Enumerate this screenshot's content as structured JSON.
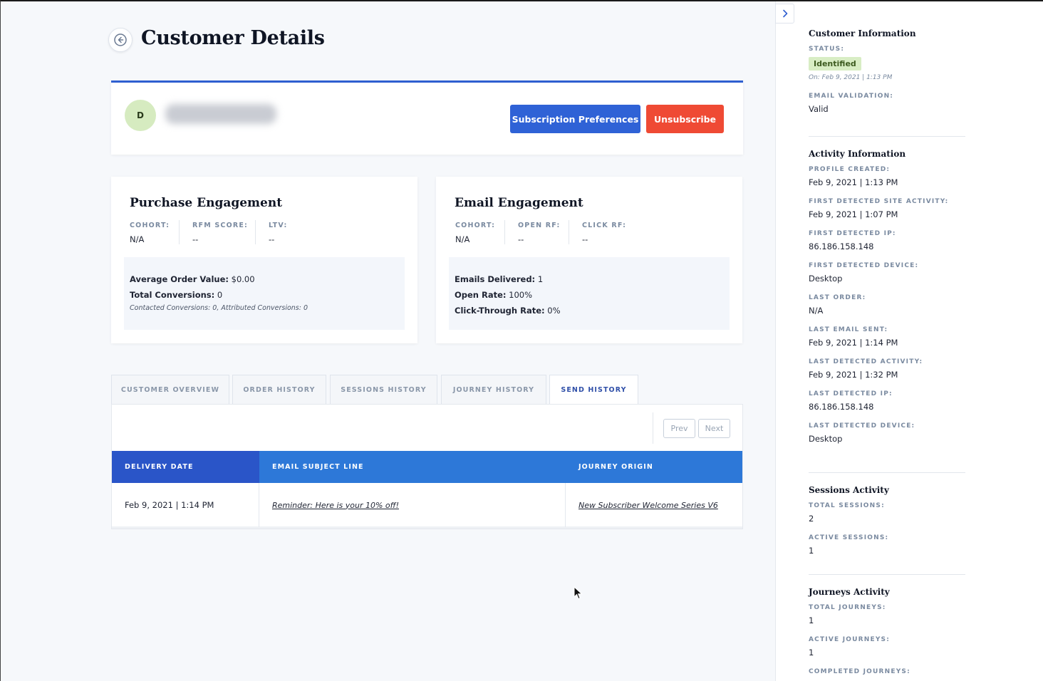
{
  "page": {
    "title": "Customer Details"
  },
  "profile": {
    "avatar_initial": "D",
    "subscription_button": "Subscription Preferences",
    "unsubscribe_button": "Unsubscribe"
  },
  "purchase": {
    "title": "Purchase Engagement",
    "metrics": [
      {
        "label": "COHORT:",
        "value": "N/A"
      },
      {
        "label": "RFM SCORE:",
        "value": "--"
      },
      {
        "label": "LTV:",
        "value": "--"
      }
    ],
    "aov_label": "Average Order Value:",
    "aov_value": " $0.00",
    "conv_label": "Total Conversions:",
    "conv_value": " 0",
    "note": "Contacted Conversions: 0, Attributed Conversions: 0"
  },
  "email": {
    "title": "Email Engagement",
    "metrics": [
      {
        "label": "COHORT:",
        "value": "N/A"
      },
      {
        "label": "OPEN RF:",
        "value": "--"
      },
      {
        "label": "CLICK RF:",
        "value": "--"
      }
    ],
    "delivered_label": "Emails Delivered:",
    "delivered_value": " 1",
    "open_label": "Open Rate:",
    "open_value": " 100%",
    "ctr_label": "Click-Through Rate:",
    "ctr_value": " 0%"
  },
  "tabs": [
    {
      "label": "CUSTOMER OVERVIEW"
    },
    {
      "label": "ORDER HISTORY"
    },
    {
      "label": "SESSIONS HISTORY"
    },
    {
      "label": "JOURNEY HISTORY"
    },
    {
      "label": "SEND HISTORY"
    }
  ],
  "pager": {
    "prev": "Prev",
    "next": "Next"
  },
  "send_table": {
    "columns": [
      "DELIVERY DATE",
      "EMAIL SUBJECT LINE",
      "JOURNEY ORIGIN"
    ],
    "rows": [
      {
        "date": "Feb 9, 2021 | 1:14 PM",
        "subject": "Reminder: Here is your 10% off!",
        "origin": "New Subscriber Welcome Series V6"
      }
    ]
  },
  "sidebar": {
    "customer_info": {
      "title": "Customer Information",
      "status_label": "STATUS:",
      "status_value": "Identified",
      "status_date": "On: Feb 9, 2021 | 1:13 PM",
      "email_validation_label": "EMAIL VALIDATION:",
      "email_validation_value": "Valid"
    },
    "activity_info": {
      "title": "Activity Information",
      "items": [
        {
          "label": "PROFILE CREATED:",
          "value": "Feb 9, 2021 | 1:13 PM"
        },
        {
          "label": "FIRST DETECTED SITE ACTIVITY:",
          "value": "Feb 9, 2021 | 1:07 PM"
        },
        {
          "label": "FIRST DETECTED IP:",
          "value": "86.186.158.148"
        },
        {
          "label": "FIRST DETECTED DEVICE:",
          "value": "Desktop"
        },
        {
          "label": "LAST ORDER:",
          "value": "N/A"
        },
        {
          "label": "LAST EMAIL SENT:",
          "value": "Feb 9, 2021 | 1:14 PM"
        },
        {
          "label": "LAST DETECTED ACTIVITY:",
          "value": "Feb 9, 2021 | 1:32 PM"
        },
        {
          "label": "LAST DETECTED IP:",
          "value": "86.186.158.148"
        },
        {
          "label": "LAST DETECTED DEVICE:",
          "value": "Desktop"
        }
      ]
    },
    "sessions_activity": {
      "title": "Sessions Activity",
      "items": [
        {
          "label": "TOTAL SESSIONS:",
          "value": "2"
        },
        {
          "label": "ACTIVE SESSIONS:",
          "value": "1"
        }
      ]
    },
    "journeys_activity": {
      "title": "Journeys Activity",
      "items": [
        {
          "label": "TOTAL JOURNEYS:",
          "value": "1"
        },
        {
          "label": "ACTIVE JOURNEYS:",
          "value": "1"
        },
        {
          "label": "COMPLETED JOURNEYS:",
          "value": ""
        }
      ]
    }
  }
}
